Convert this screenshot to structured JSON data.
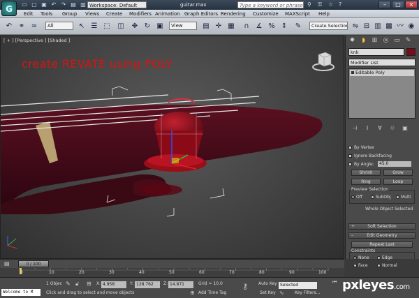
{
  "titlebar": {
    "logo_letter": "G",
    "workspace": "Workspace: Default",
    "filename": "guitar.max",
    "search_placeholder": "Type a keyword or phrase"
  },
  "menu": [
    "Edit",
    "Tools",
    "Group",
    "Views",
    "Create",
    "Modifiers",
    "Animation",
    "Graph Editors",
    "Rendering",
    "Customize",
    "MAXScript",
    "Help"
  ],
  "toolbar": {
    "selection_filter": "All",
    "reference_coord": "View",
    "create_selection_set": "Create Selection S..."
  },
  "viewport": {
    "label": "[ + ] [Perspective ] [Shaded ]",
    "annotation": "create REVATE using POLY"
  },
  "command_panel": {
    "object_name": "knk",
    "modifier_list": "Modifier List",
    "stack_item": "Editable Poly",
    "by_vertex": "By Vertex",
    "ignore_backfacing": "Ignore Backfacing",
    "by_angle": "By Angle:",
    "angle_value": "45.0",
    "shrink": "Shrink",
    "grow": "Grow",
    "ring": "Ring",
    "loop": "Loop",
    "preview_selection": "Preview Selection",
    "preview_off": "Off",
    "preview_subobj": "SubObj",
    "preview_multi": "Multi",
    "whole_object_selected": "Whole Object Selected",
    "soft_selection": "Soft Selection",
    "edit_geometry": "Edit Geometry",
    "repeat_last": "Repeat Last",
    "constraints": "Constraints",
    "c_none": "None",
    "c_edge": "Edge",
    "c_face": "Face",
    "c_normal": "Normal"
  },
  "timeline": {
    "slider_label": "0 / 100",
    "ticks": [
      "0",
      "10",
      "20",
      "30",
      "40",
      "50",
      "60",
      "70",
      "80",
      "90",
      "100"
    ]
  },
  "statusbar": {
    "listener": "Welcome to M",
    "selection_count": "1 Objec",
    "prompt": "Click and drag to select and move objects",
    "x_label": "X:",
    "x_value": "4.958",
    "y_label": "Y:",
    "y_value": "128.762",
    "z_label": "Z:",
    "z_value": "14.871",
    "grid": "Grid = 10.0",
    "add_time_tag": "Add Time Tag",
    "auto_key": "Auto Key",
    "auto_key_value": "Selected",
    "set_key": "Set Key",
    "key_filters": "Key Filters..."
  },
  "watermark": {
    "main": "pxleyes",
    "suffix": ".com"
  }
}
